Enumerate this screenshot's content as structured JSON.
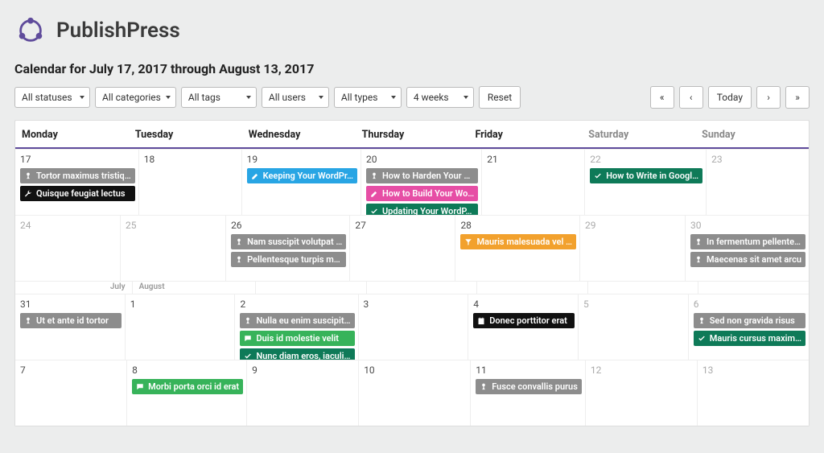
{
  "brand": "PublishPress",
  "range_title": "Calendar for July 17, 2017 through August 13, 2017",
  "filters": {
    "status": "All statuses",
    "category": "All categories",
    "tag": "All tags",
    "user": "All users",
    "type": "All types",
    "duration": "4 weeks"
  },
  "buttons": {
    "reset": "Reset",
    "today": "Today"
  },
  "nav": {
    "first": "«",
    "prev": "‹",
    "next": "›",
    "last": "»"
  },
  "month_labels": {
    "july": "July",
    "august": "August"
  },
  "weekdays": [
    "Monday",
    "Tuesday",
    "Wednesday",
    "Thursday",
    "Friday",
    "Saturday",
    "Sunday"
  ],
  "cells": [
    [
      {
        "n": "17",
        "muted": false,
        "items": [
          {
            "c": "gray",
            "i": "pin",
            "t": "Tortor maximus tristiq…"
          },
          {
            "c": "black",
            "i": "wrench",
            "t": "Quisque feugiat lectus"
          }
        ]
      },
      {
        "n": "18",
        "muted": false,
        "items": []
      },
      {
        "n": "19",
        "muted": false,
        "items": [
          {
            "c": "blue",
            "i": "pencil",
            "t": "Keeping Your WordPr…"
          }
        ]
      },
      {
        "n": "20",
        "muted": false,
        "items": [
          {
            "c": "gray",
            "i": "pin",
            "t": "How to Harden Your …"
          },
          {
            "c": "pink",
            "i": "pencil",
            "t": "How to Build Your Wo…"
          },
          {
            "c": "teal",
            "i": "check",
            "t": "Updating Your WordP…"
          }
        ]
      },
      {
        "n": "21",
        "muted": false,
        "items": []
      },
      {
        "n": "22",
        "muted": true,
        "items": [
          {
            "c": "teal",
            "i": "check",
            "t": "How to Write in Googl…"
          }
        ]
      },
      {
        "n": "23",
        "muted": true,
        "items": []
      }
    ],
    [
      {
        "n": "24",
        "muted": true,
        "items": []
      },
      {
        "n": "25",
        "muted": true,
        "items": []
      },
      {
        "n": "26",
        "muted": false,
        "items": [
          {
            "c": "gray",
            "i": "pin",
            "t": "Nam suscipit volutpat …"
          },
          {
            "c": "gray",
            "i": "pin",
            "t": "Pellentesque turpis m…"
          }
        ]
      },
      {
        "n": "27",
        "muted": false,
        "items": []
      },
      {
        "n": "28",
        "muted": false,
        "items": [
          {
            "c": "orange",
            "i": "funnel",
            "t": "Mauris malesuada vel …"
          }
        ]
      },
      {
        "n": "29",
        "muted": true,
        "items": []
      },
      {
        "n": "30",
        "muted": true,
        "items": [
          {
            "c": "gray",
            "i": "pin",
            "t": "In fermentum pellente…"
          },
          {
            "c": "gray",
            "i": "pin",
            "t": "Maecenas sit amet arcu"
          }
        ]
      }
    ],
    [
      {
        "n": "31",
        "muted": false,
        "items": [
          {
            "c": "gray",
            "i": "pin",
            "t": "Ut et ante id tortor"
          }
        ]
      },
      {
        "n": "1",
        "muted": false,
        "items": []
      },
      {
        "n": "2",
        "muted": false,
        "items": [
          {
            "c": "gray",
            "i": "pin",
            "t": "Nulla eu enim suscipit…"
          },
          {
            "c": "green",
            "i": "chat",
            "t": "Duis id molestie velit"
          },
          {
            "c": "teal",
            "i": "check",
            "t": "Nunc diam eros, iaculi…"
          }
        ]
      },
      {
        "n": "3",
        "muted": false,
        "items": []
      },
      {
        "n": "4",
        "muted": false,
        "items": [
          {
            "c": "black",
            "i": "cal",
            "t": "Donec porttitor erat"
          }
        ]
      },
      {
        "n": "5",
        "muted": true,
        "items": []
      },
      {
        "n": "6",
        "muted": true,
        "items": [
          {
            "c": "gray",
            "i": "pin",
            "t": "Sed non gravida risus"
          },
          {
            "c": "teal",
            "i": "check",
            "t": "Mauris cursus maxim…"
          }
        ]
      }
    ],
    [
      {
        "n": "7",
        "muted": false,
        "items": []
      },
      {
        "n": "8",
        "muted": false,
        "items": [
          {
            "c": "green",
            "i": "chat",
            "t": "Morbi porta orci id erat"
          }
        ]
      },
      {
        "n": "9",
        "muted": false,
        "items": []
      },
      {
        "n": "10",
        "muted": false,
        "items": []
      },
      {
        "n": "11",
        "muted": false,
        "items": [
          {
            "c": "gray",
            "i": "pin",
            "t": "Fusce convallis purus"
          }
        ]
      },
      {
        "n": "12",
        "muted": true,
        "items": []
      },
      {
        "n": "13",
        "muted": true,
        "items": []
      }
    ]
  ]
}
